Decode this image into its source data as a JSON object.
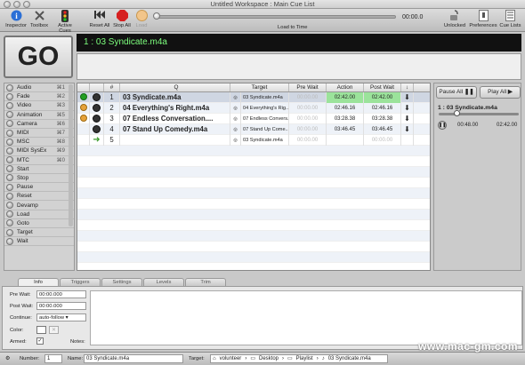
{
  "window": {
    "title": "Untitled Workspace : Main Cue List"
  },
  "toolbar": {
    "inspector": "Inspector",
    "toolbox": "Toolbox",
    "active_cues": "Active Cues",
    "reset_all": "Reset All",
    "stop_all": "Stop All",
    "load": "Load",
    "time": "00:00.0",
    "load_to_time": "Load to Time",
    "unlocked": "Unlocked",
    "preferences": "Preferences",
    "cue_lists": "Cue Lists"
  },
  "go": {
    "label": "GO"
  },
  "standby": {
    "text": "1 : 03 Syndicate.m4a"
  },
  "sidebar": {
    "items": [
      {
        "label": "Audio",
        "shortcut": "⌘1"
      },
      {
        "label": "Fade",
        "shortcut": "⌘2"
      },
      {
        "label": "Video",
        "shortcut": "⌘3"
      },
      {
        "label": "Animation",
        "shortcut": "⌘5"
      },
      {
        "label": "Camera",
        "shortcut": "⌘6"
      },
      {
        "label": "MIDI",
        "shortcut": "⌘7"
      },
      {
        "label": "MSC",
        "shortcut": "⌘8"
      },
      {
        "label": "MIDI SysEx",
        "shortcut": "⌘9"
      },
      {
        "label": "MTC",
        "shortcut": "⌘0"
      },
      {
        "label": "Start",
        "shortcut": ""
      },
      {
        "label": "Stop",
        "shortcut": ""
      },
      {
        "label": "Pause",
        "shortcut": ""
      },
      {
        "label": "Reset",
        "shortcut": ""
      },
      {
        "label": "Devamp",
        "shortcut": ""
      },
      {
        "label": "Load",
        "shortcut": ""
      },
      {
        "label": "Goto",
        "shortcut": ""
      },
      {
        "label": "Target",
        "shortcut": ""
      },
      {
        "label": "Wait",
        "shortcut": ""
      }
    ]
  },
  "table": {
    "headers": {
      "num": "#",
      "q": "Q",
      "target": "Target",
      "pre_wait": "Pre Wait",
      "action": "Action",
      "post_wait": "Post Wait",
      "cont": "↓"
    },
    "rows": [
      {
        "num": "1",
        "q": "03 Syndicate.m4a",
        "target": "03 Syndicate.m4a",
        "pre_wait": "00:00.00",
        "action": "02:42.00",
        "post_wait": "02:42.00",
        "status": "play"
      },
      {
        "num": "2",
        "q": "04 Everything's Right.m4a",
        "target": "04 Everything's Rig...",
        "pre_wait": "00:00.00",
        "action": "02:46.16",
        "post_wait": "02:46.16",
        "status": "wait"
      },
      {
        "num": "3",
        "q": "07 Endless Conversation....",
        "target": "07 Endless Convers...",
        "pre_wait": "00:00.00",
        "action": "03:28.38",
        "post_wait": "03:28.38",
        "status": "wait"
      },
      {
        "num": "4",
        "q": "07 Stand Up Comedy.m4a",
        "target": "07 Stand Up Come...",
        "pre_wait": "00:00.00",
        "action": "03:46.45",
        "post_wait": "03:46.45",
        "status": "none"
      },
      {
        "num": "5",
        "q": "",
        "target": "03 Syndicate.m4a",
        "pre_wait": "00:00.00",
        "action": "",
        "post_wait": "00:00.00",
        "status": "goto"
      }
    ]
  },
  "right_panel": {
    "pause_all": "Pause All",
    "play_all": "Play All",
    "cue_name": "1 : 03 Syndicate.m4a",
    "elapsed": "00:48.00",
    "total": "02:42.00"
  },
  "inspector": {
    "tabs": [
      "Info",
      "Triggers",
      "Settings",
      "Levels",
      "Trim"
    ],
    "pre_wait_label": "Pre Wait:",
    "pre_wait_value": "00:00.000",
    "post_wait_label": "Post Wait:",
    "post_wait_value": "00:00.000",
    "continue_label": "Continue:",
    "continue_value": "auto-follow",
    "color_label": "Color:",
    "armed_label": "Armed:",
    "notes_label": "Notes:"
  },
  "statusbar": {
    "number_label": "Number:",
    "number_value": "1",
    "name_label": "Name:",
    "name_value": "03 Syndicate.m4a",
    "target_label": "Target:",
    "path": [
      "volunteer",
      "Desktop",
      "Playlist",
      "03 Syndicate.m4a"
    ]
  },
  "watermark": "www.mac-gm.com",
  "colors": {
    "standby_text": "#7dff7d",
    "action_highlight": "#9be39b",
    "stop_red": "#d62020",
    "play_green": "#23a023"
  }
}
